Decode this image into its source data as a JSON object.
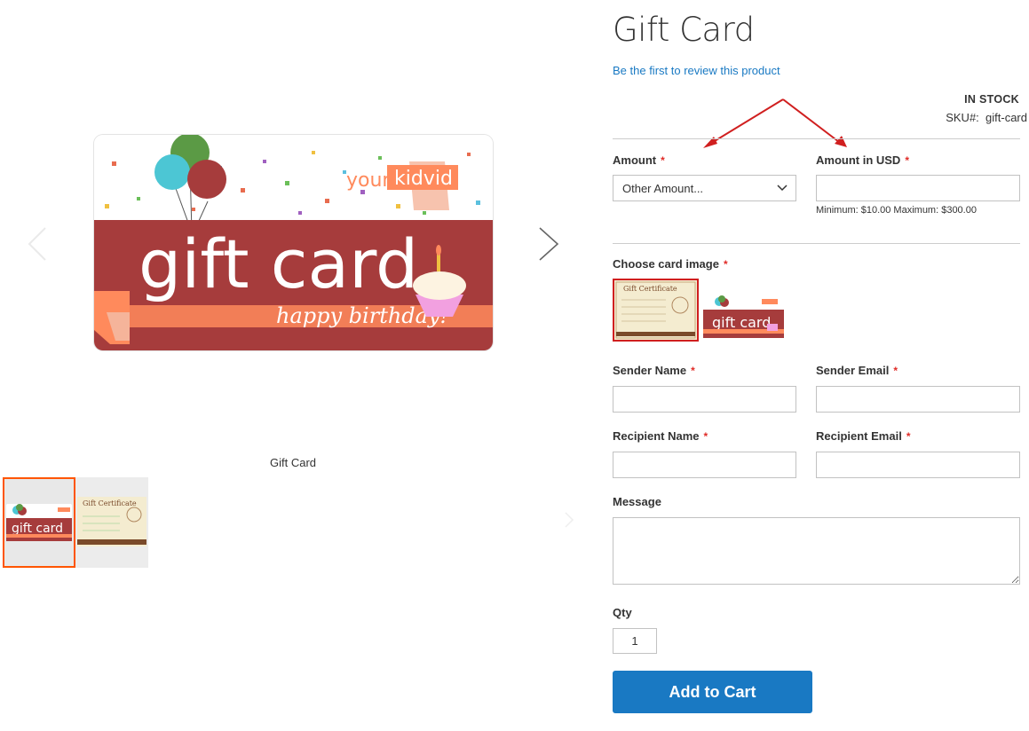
{
  "product": {
    "title": "Gift Card",
    "review_link": "Be the first to review this product",
    "stock_status": "IN STOCK",
    "sku_label": "SKU#:",
    "sku_value": "gift-card"
  },
  "gallery": {
    "caption": "Gift Card",
    "main_image": {
      "logo_text_1": "your",
      "logo_text_2": "kidvid",
      "headline": "gift card",
      "subline": "happy birthday!"
    },
    "thumbnails": [
      {
        "name": "birthday-card",
        "active": true
      },
      {
        "name": "gift-certificate",
        "active": false
      }
    ]
  },
  "form": {
    "amount": {
      "label": "Amount",
      "required_mark": "*",
      "selected": "Other Amount..."
    },
    "amount_usd": {
      "label": "Amount in USD",
      "required_mark": "*",
      "value": "",
      "note": "Minimum: $10.00 Maximum: $300.00"
    },
    "card_image": {
      "label": "Choose card image",
      "required_mark": "*",
      "options": [
        {
          "title": "Gift Certificate",
          "selected": true
        },
        {
          "title": "gift card",
          "selected": false
        }
      ]
    },
    "sender_name": {
      "label": "Sender Name",
      "required_mark": "*",
      "value": ""
    },
    "sender_email": {
      "label": "Sender Email",
      "required_mark": "*",
      "value": ""
    },
    "recipient_name": {
      "label": "Recipient Name",
      "required_mark": "*",
      "value": ""
    },
    "recipient_email": {
      "label": "Recipient Email",
      "required_mark": "*",
      "value": ""
    },
    "message": {
      "label": "Message",
      "value": ""
    },
    "qty": {
      "label": "Qty",
      "value": "1"
    },
    "add_to_cart": "Add to Cart"
  },
  "colors": {
    "accent_blue": "#1979c3",
    "required_red": "#e02b27",
    "annotation_red": "#d01f1f",
    "card_maroon": "#a63c3c",
    "card_orange": "#ff8a5c",
    "thumb_active_border": "#ff5501"
  }
}
